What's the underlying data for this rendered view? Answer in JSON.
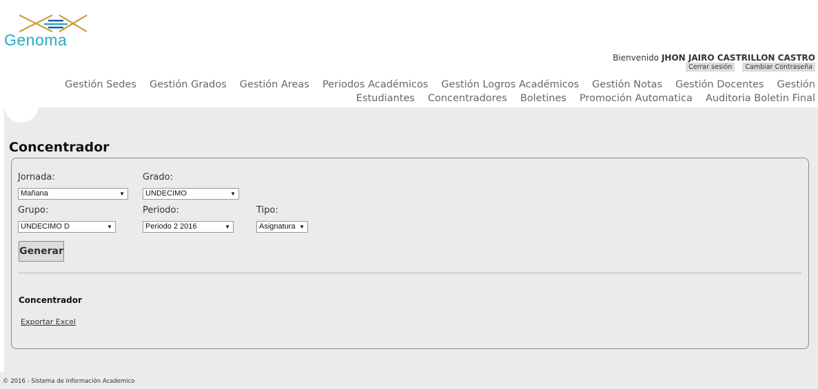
{
  "brand": {
    "logo_text": "Genoma"
  },
  "header": {
    "welcome_prefix": "Bienvenido",
    "user_name": "JHON JAIRO CASTRILLON CASTRO",
    "logout_label": "Cerrar sesión",
    "change_password_label": "Cambiar Contraseña"
  },
  "nav": {
    "items": [
      "Gestión Sedes",
      "Gestión Grados",
      "Gestión Areas",
      "Periodos Académicos",
      "Gestión Logros Académicos",
      "Gestión Notas",
      "Gestión Docentes",
      "Gestión",
      "Estudiantes",
      "Concentradores",
      "Boletines",
      "Promoción Automatica",
      "Auditoria Boletin Final"
    ]
  },
  "page": {
    "title": "Concentrador"
  },
  "form": {
    "jornada_label": "Jornada:",
    "jornada_value": "Mañana",
    "grado_label": "Grado:",
    "grado_value": "UNDECIMO",
    "grupo_label": "Grupo:",
    "grupo_value": "UNDECIMO D",
    "periodo_label": "Periodo:",
    "periodo_value": "Periodo 2 2016",
    "tipo_label": "Tipo:",
    "tipo_value": "Asignatura",
    "generate_label": "Generar"
  },
  "results": {
    "title": "Concentrador",
    "export_label": "Exportar Excel"
  },
  "footer": {
    "text": "© 2016 - Sistema de Información Academico"
  },
  "colors": {
    "brand_blue": "#28a8c8",
    "brand_gold": "#c8a040",
    "panel_bg": "#ebebeb"
  }
}
